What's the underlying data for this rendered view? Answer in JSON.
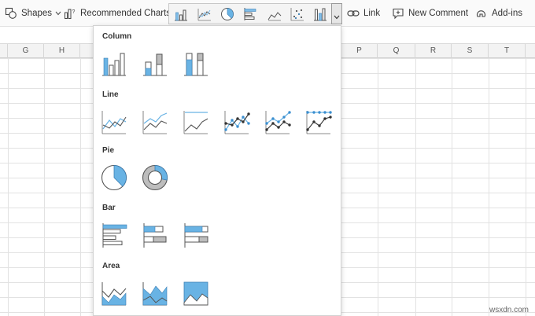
{
  "ribbon": {
    "shapes_label": "Shapes",
    "recommended_charts_label": "Recommended Charts",
    "link_label": "Link",
    "new_comment_label": "New Comment",
    "add_ins_label": "Add-ins",
    "chart_strip_icons": [
      "column-chart-icon",
      "line-chart-icon",
      "pie-chart-icon",
      "bar-chart-icon",
      "area-chart-icon",
      "scatter-chart-icon",
      "other-charts-icon"
    ]
  },
  "sheet": {
    "columns": [
      "G",
      "H",
      "P",
      "Q",
      "R",
      "S",
      "T"
    ]
  },
  "chart_gallery": {
    "sections": [
      {
        "title": "Column",
        "items": [
          "clustered-column",
          "stacked-column",
          "100-percent-stacked-column"
        ]
      },
      {
        "title": "Line",
        "items": [
          "line",
          "stacked-line",
          "100-percent-stacked-line",
          "line-with-markers",
          "stacked-line-with-markers",
          "100-percent-stacked-line-with-markers"
        ]
      },
      {
        "title": "Pie",
        "items": [
          "pie",
          "doughnut"
        ]
      },
      {
        "title": "Bar",
        "items": [
          "clustered-bar",
          "stacked-bar",
          "100-percent-stacked-bar"
        ]
      },
      {
        "title": "Area",
        "items": [
          "area",
          "stacked-area",
          "100-percent-stacked-area"
        ]
      }
    ]
  },
  "watermark": "wsxdn.com",
  "colors": {
    "accent_blue": "#69b3e4",
    "secondary_gray": "#bdbdbd",
    "ribbon_bg": "#fafafa",
    "grid_line": "#e2e2e2"
  }
}
